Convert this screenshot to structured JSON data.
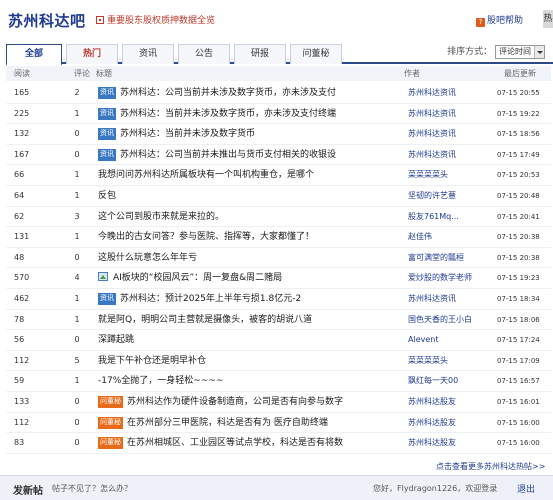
{
  "forum_title": "苏州科达吧",
  "notice": "重要股东股权质押数据全览",
  "help": "股吧帮助",
  "side_tab": "热",
  "tabs": [
    "全部",
    "热门",
    "资讯",
    "公告",
    "研报",
    "问董秘"
  ],
  "sort_label": "排序方式：",
  "sort_value": "评论时间",
  "headers": {
    "read": "阅读",
    "reply": "评论",
    "title": "标题",
    "author": "作者",
    "time": "最后更新"
  },
  "posts": [
    {
      "read": "165",
      "reply": "2",
      "tag": "资讯",
      "title": "苏州科达：公司当前并未涉及数字货币，亦未涉及支付",
      "author": "苏州科达资讯",
      "time": "07-15 20:55"
    },
    {
      "read": "225",
      "reply": "1",
      "tag": "资讯",
      "title": "苏州科达：当前并未涉及数字货币，亦未涉及支付终端",
      "author": "苏州科达资讯",
      "time": "07-15 19:22"
    },
    {
      "read": "132",
      "reply": "0",
      "tag": "资讯",
      "title": "苏州科达：当前并未涉及数字货币",
      "author": "苏州科达资讯",
      "time": "07-15 18:56"
    },
    {
      "read": "167",
      "reply": "0",
      "tag": "资讯",
      "title": "苏州科达：公司当前并未推出与货币支付相关的收银设",
      "author": "苏州科达资讯",
      "time": "07-15 17:49"
    },
    {
      "read": "66",
      "reply": "1",
      "tag": "",
      "title": "我想问问苏州科达所属板块有一个叫机构重仓，是哪个",
      "author": "菜菜菜菜头",
      "time": "07-15 20:53"
    },
    {
      "read": "64",
      "reply": "1",
      "tag": "",
      "title": "反包",
      "author": "坚韧的许艺薏",
      "time": "07-15 20:48"
    },
    {
      "read": "62",
      "reply": "3",
      "tag": "",
      "title": "这个公司到股市来就是来拉的。",
      "author": "股友761Mq...",
      "time": "07-15 20:41"
    },
    {
      "read": "131",
      "reply": "1",
      "tag": "",
      "title": "今晚出的古女问答？参与医院、指挥等，大家都懂了！",
      "author": "赵佳伟",
      "time": "07-15 20:38"
    },
    {
      "read": "48",
      "reply": "0",
      "tag": "",
      "title": "这股什么玩意怎么年年亏",
      "author": "富可满堂的瓢桓",
      "time": "07-15 20:38"
    },
    {
      "read": "570",
      "reply": "4",
      "tag": "img",
      "title": "AI板块的“校园风云”：周一复盘&周二赌局",
      "author": "爱炒股的数学老师",
      "time": "07-15 19:23"
    },
    {
      "read": "462",
      "reply": "1",
      "tag": "资讯",
      "title": "苏州科达：预计2025年上半年亏损1.8亿元-2",
      "author": "苏州科达资讯",
      "time": "07-15 18:34"
    },
    {
      "read": "78",
      "reply": "1",
      "tag": "",
      "title": "就是阿Q，明明公司主营就是摄像头，被客的胡说八道",
      "author": "国色天香的王小白",
      "time": "07-15 18:06"
    },
    {
      "read": "56",
      "reply": "0",
      "tag": "",
      "title": "深蹲起跳",
      "author": "Alevent",
      "time": "07-15 17:24"
    },
    {
      "read": "112",
      "reply": "5",
      "tag": "",
      "title": "我是下午补仓还是明早补仓",
      "author": "菜菜菜菜头",
      "time": "07-15 17:09"
    },
    {
      "read": "59",
      "reply": "1",
      "tag": "",
      "title": "-17%全抛了，一身轻松~~~~",
      "author": "飘红每一天00",
      "time": "07-15 16:57"
    },
    {
      "read": "133",
      "reply": "0",
      "tag": "问董秘",
      "title": "苏州科达作为硬件设备制造商，公司是否有向参与数字",
      "author": "苏州科达股友",
      "time": "07-15 16:01"
    },
    {
      "read": "112",
      "reply": "0",
      "tag": "问董秘",
      "title": "在苏州部分三甲医院，科达是否有为 医疗自助终端",
      "author": "苏州科达股友",
      "time": "07-15 16:00"
    },
    {
      "read": "83",
      "reply": "0",
      "tag": "问董秘",
      "title": "在苏州相城区、工业园区等试点学校，科达是否有将数",
      "author": "苏州科达股友",
      "time": "07-15 16:00"
    }
  ],
  "more_link": "点击查看更多苏州科达热帖>>",
  "footer": {
    "title": "发新帖",
    "sub": "帖子不见了？怎么办？",
    "user": "您好，Flydragon1226，欢迎登录",
    "logout": "退出"
  },
  "colors": {
    "brand": "#1f3a93",
    "hot": "#c0392b",
    "news_tag": "#3a78c3",
    "ask_tag": "#e86b1a"
  }
}
